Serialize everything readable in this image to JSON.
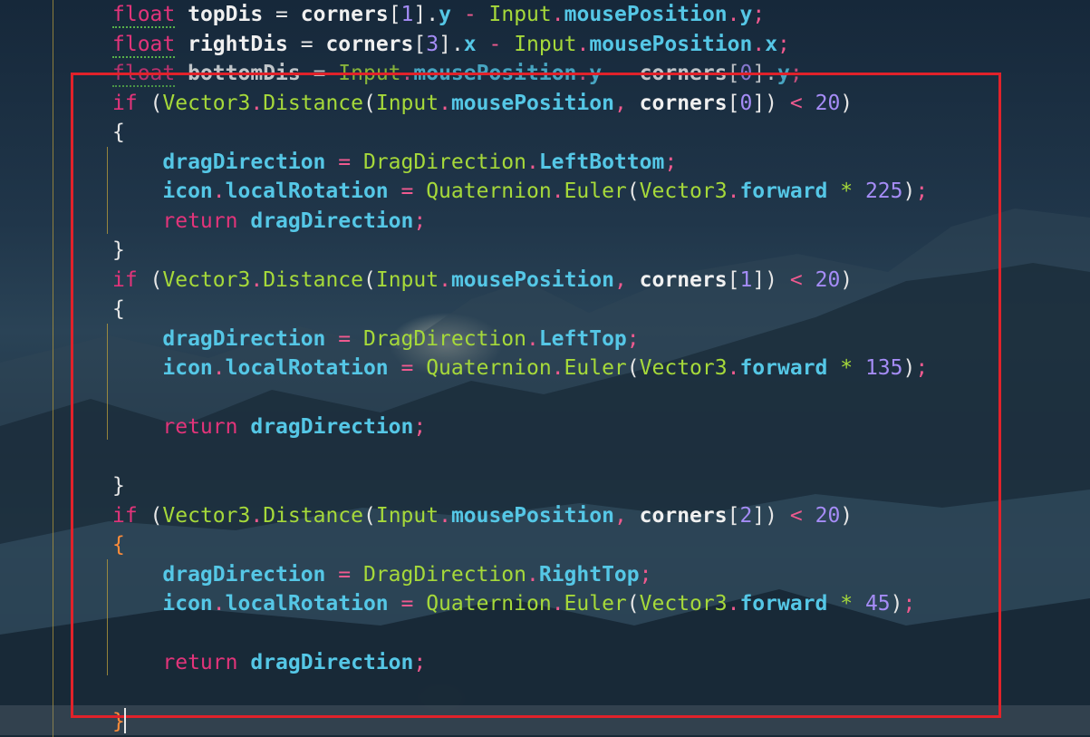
{
  "code": {
    "lines": [
      {
        "tokens": [
          {
            "t": "float",
            "c": "kw squig"
          },
          {
            "t": " ",
            "c": "pn"
          },
          {
            "t": "topDis",
            "c": "var"
          },
          {
            "t": " = ",
            "c": "pn"
          },
          {
            "t": "corners",
            "c": "var"
          },
          {
            "t": "[",
            "c": "pn"
          },
          {
            "t": "1",
            "c": "num"
          },
          {
            "t": "].",
            "c": "pn"
          },
          {
            "t": "y",
            "c": "fld"
          },
          {
            "t": " - ",
            "c": "op"
          },
          {
            "t": "Input",
            "c": "ty"
          },
          {
            "t": ".",
            "c": "op"
          },
          {
            "t": "mousePosition",
            "c": "fld"
          },
          {
            "t": ".",
            "c": "op"
          },
          {
            "t": "y",
            "c": "fld"
          },
          {
            "t": ";",
            "c": "op"
          }
        ]
      },
      {
        "tokens": [
          {
            "t": "float",
            "c": "kw squig"
          },
          {
            "t": " ",
            "c": "pn"
          },
          {
            "t": "rightDis",
            "c": "var"
          },
          {
            "t": " = ",
            "c": "pn"
          },
          {
            "t": "corners",
            "c": "var"
          },
          {
            "t": "[",
            "c": "pn"
          },
          {
            "t": "3",
            "c": "num"
          },
          {
            "t": "].",
            "c": "pn"
          },
          {
            "t": "x",
            "c": "fld"
          },
          {
            "t": " - ",
            "c": "op"
          },
          {
            "t": "Input",
            "c": "ty"
          },
          {
            "t": ".",
            "c": "op"
          },
          {
            "t": "mousePosition",
            "c": "fld"
          },
          {
            "t": ".",
            "c": "op"
          },
          {
            "t": "x",
            "c": "fld"
          },
          {
            "t": ";",
            "c": "op"
          }
        ]
      },
      {
        "tokens": [
          {
            "t": "float",
            "c": "kw squig"
          },
          {
            "t": " ",
            "c": "pn"
          },
          {
            "t": "bottomDis",
            "c": "var"
          },
          {
            "t": " = ",
            "c": "pn"
          },
          {
            "t": "Input",
            "c": "ty"
          },
          {
            "t": ".",
            "c": "op"
          },
          {
            "t": "mousePosition",
            "c": "fld"
          },
          {
            "t": ".",
            "c": "op"
          },
          {
            "t": "y",
            "c": "fld"
          },
          {
            "t": " - ",
            "c": "op"
          },
          {
            "t": "corners",
            "c": "var"
          },
          {
            "t": "[",
            "c": "pn"
          },
          {
            "t": "0",
            "c": "num"
          },
          {
            "t": "].",
            "c": "pn"
          },
          {
            "t": "y",
            "c": "fld"
          },
          {
            "t": ";",
            "c": "op"
          }
        ]
      },
      {
        "tokens": [
          {
            "t": "if",
            "c": "kw"
          },
          {
            "t": " (",
            "c": "pn"
          },
          {
            "t": "Vector3",
            "c": "ty"
          },
          {
            "t": ".",
            "c": "op"
          },
          {
            "t": "Distance",
            "c": "ty"
          },
          {
            "t": "(",
            "c": "pn"
          },
          {
            "t": "Input",
            "c": "ty"
          },
          {
            "t": ".",
            "c": "op"
          },
          {
            "t": "mousePosition",
            "c": "fld"
          },
          {
            "t": ", ",
            "c": "op"
          },
          {
            "t": "corners",
            "c": "var"
          },
          {
            "t": "[",
            "c": "pn"
          },
          {
            "t": "0",
            "c": "num"
          },
          {
            "t": "]) ",
            "c": "pn"
          },
          {
            "t": "<",
            "c": "op"
          },
          {
            "t": " ",
            "c": "pn"
          },
          {
            "t": "20",
            "c": "num"
          },
          {
            "t": ")",
            "c": "pn"
          }
        ]
      },
      {
        "tokens": [
          {
            "t": "{",
            "c": "pn"
          }
        ]
      },
      {
        "tokens": [
          {
            "t": "    ",
            "c": "pn"
          },
          {
            "t": "dragDirection",
            "c": "fld"
          },
          {
            "t": " = ",
            "c": "op"
          },
          {
            "t": "DragDirection",
            "c": "ty"
          },
          {
            "t": ".",
            "c": "op"
          },
          {
            "t": "LeftBottom",
            "c": "fld"
          },
          {
            "t": ";",
            "c": "op"
          }
        ]
      },
      {
        "tokens": [
          {
            "t": "    ",
            "c": "pn"
          },
          {
            "t": "icon",
            "c": "fld"
          },
          {
            "t": ".",
            "c": "op"
          },
          {
            "t": "localRotation",
            "c": "fld"
          },
          {
            "t": " = ",
            "c": "op"
          },
          {
            "t": "Quaternion",
            "c": "ty"
          },
          {
            "t": ".",
            "c": "op"
          },
          {
            "t": "Euler",
            "c": "ty"
          },
          {
            "t": "(",
            "c": "pn"
          },
          {
            "t": "Vector3",
            "c": "ty"
          },
          {
            "t": ".",
            "c": "op"
          },
          {
            "t": "forward",
            "c": "fld"
          },
          {
            "t": " * ",
            "c": "ty"
          },
          {
            "t": "225",
            "c": "num"
          },
          {
            "t": ")",
            "c": "pn"
          },
          {
            "t": ";",
            "c": "op"
          }
        ]
      },
      {
        "tokens": [
          {
            "t": "    ",
            "c": "pn"
          },
          {
            "t": "return",
            "c": "kw"
          },
          {
            "t": " ",
            "c": "pn"
          },
          {
            "t": "dragDirection",
            "c": "fld"
          },
          {
            "t": ";",
            "c": "op"
          }
        ]
      },
      {
        "tokens": [
          {
            "t": "}",
            "c": "pn"
          }
        ]
      },
      {
        "tokens": [
          {
            "t": "if",
            "c": "kw"
          },
          {
            "t": " (",
            "c": "pn"
          },
          {
            "t": "Vector3",
            "c": "ty"
          },
          {
            "t": ".",
            "c": "op"
          },
          {
            "t": "Distance",
            "c": "ty"
          },
          {
            "t": "(",
            "c": "pn"
          },
          {
            "t": "Input",
            "c": "ty"
          },
          {
            "t": ".",
            "c": "op"
          },
          {
            "t": "mousePosition",
            "c": "fld"
          },
          {
            "t": ", ",
            "c": "op"
          },
          {
            "t": "corners",
            "c": "var"
          },
          {
            "t": "[",
            "c": "pn"
          },
          {
            "t": "1",
            "c": "num"
          },
          {
            "t": "]) ",
            "c": "pn"
          },
          {
            "t": "<",
            "c": "op"
          },
          {
            "t": " ",
            "c": "pn"
          },
          {
            "t": "20",
            "c": "num"
          },
          {
            "t": ")",
            "c": "pn"
          }
        ]
      },
      {
        "tokens": [
          {
            "t": "{",
            "c": "pn"
          }
        ]
      },
      {
        "tokens": [
          {
            "t": "    ",
            "c": "pn"
          },
          {
            "t": "dragDirection",
            "c": "fld"
          },
          {
            "t": " = ",
            "c": "op"
          },
          {
            "t": "DragDirection",
            "c": "ty"
          },
          {
            "t": ".",
            "c": "op"
          },
          {
            "t": "LeftTop",
            "c": "fld"
          },
          {
            "t": ";",
            "c": "op"
          }
        ]
      },
      {
        "tokens": [
          {
            "t": "    ",
            "c": "pn"
          },
          {
            "t": "icon",
            "c": "fld"
          },
          {
            "t": ".",
            "c": "op"
          },
          {
            "t": "localRotation",
            "c": "fld"
          },
          {
            "t": " = ",
            "c": "op"
          },
          {
            "t": "Quaternion",
            "c": "ty"
          },
          {
            "t": ".",
            "c": "op"
          },
          {
            "t": "Euler",
            "c": "ty"
          },
          {
            "t": "(",
            "c": "pn"
          },
          {
            "t": "Vector3",
            "c": "ty"
          },
          {
            "t": ".",
            "c": "op"
          },
          {
            "t": "forward",
            "c": "fld"
          },
          {
            "t": " * ",
            "c": "ty"
          },
          {
            "t": "135",
            "c": "num"
          },
          {
            "t": ")",
            "c": "pn"
          },
          {
            "t": ";",
            "c": "op"
          }
        ]
      },
      {
        "tokens": []
      },
      {
        "tokens": [
          {
            "t": "    ",
            "c": "pn"
          },
          {
            "t": "return",
            "c": "kw"
          },
          {
            "t": " ",
            "c": "pn"
          },
          {
            "t": "dragDirection",
            "c": "fld"
          },
          {
            "t": ";",
            "c": "op"
          }
        ]
      },
      {
        "tokens": []
      },
      {
        "tokens": [
          {
            "t": "}",
            "c": "pn"
          }
        ]
      },
      {
        "tokens": [
          {
            "t": "if",
            "c": "kw"
          },
          {
            "t": " (",
            "c": "pn"
          },
          {
            "t": "Vector3",
            "c": "ty"
          },
          {
            "t": ".",
            "c": "op"
          },
          {
            "t": "Distance",
            "c": "ty"
          },
          {
            "t": "(",
            "c": "pn"
          },
          {
            "t": "Input",
            "c": "ty"
          },
          {
            "t": ".",
            "c": "op"
          },
          {
            "t": "mousePosition",
            "c": "fld"
          },
          {
            "t": ", ",
            "c": "op"
          },
          {
            "t": "corners",
            "c": "var"
          },
          {
            "t": "[",
            "c": "pn"
          },
          {
            "t": "2",
            "c": "num"
          },
          {
            "t": "]) ",
            "c": "pn"
          },
          {
            "t": "<",
            "c": "op"
          },
          {
            "t": " ",
            "c": "pn"
          },
          {
            "t": "20",
            "c": "num"
          },
          {
            "t": ")",
            "c": "pn"
          }
        ]
      },
      {
        "tokens": [
          {
            "t": "{",
            "c": "orn"
          }
        ]
      },
      {
        "tokens": [
          {
            "t": "    ",
            "c": "pn"
          },
          {
            "t": "dragDirection",
            "c": "fld"
          },
          {
            "t": " = ",
            "c": "op"
          },
          {
            "t": "DragDirection",
            "c": "ty"
          },
          {
            "t": ".",
            "c": "op"
          },
          {
            "t": "RightTop",
            "c": "fld"
          },
          {
            "t": ";",
            "c": "op"
          }
        ]
      },
      {
        "tokens": [
          {
            "t": "    ",
            "c": "pn"
          },
          {
            "t": "icon",
            "c": "fld"
          },
          {
            "t": ".",
            "c": "op"
          },
          {
            "t": "localRotation",
            "c": "fld"
          },
          {
            "t": " = ",
            "c": "op"
          },
          {
            "t": "Quaternion",
            "c": "ty"
          },
          {
            "t": ".",
            "c": "op"
          },
          {
            "t": "Euler",
            "c": "ty"
          },
          {
            "t": "(",
            "c": "pn"
          },
          {
            "t": "Vector3",
            "c": "ty"
          },
          {
            "t": ".",
            "c": "op"
          },
          {
            "t": "forward",
            "c": "fld"
          },
          {
            "t": " * ",
            "c": "ty"
          },
          {
            "t": "45",
            "c": "num"
          },
          {
            "t": ")",
            "c": "pn"
          },
          {
            "t": ";",
            "c": "op"
          }
        ]
      },
      {
        "tokens": []
      },
      {
        "tokens": [
          {
            "t": "    ",
            "c": "pn"
          },
          {
            "t": "return",
            "c": "kw"
          },
          {
            "t": " ",
            "c": "pn"
          },
          {
            "t": "dragDirection",
            "c": "fld"
          },
          {
            "t": ";",
            "c": "op"
          }
        ]
      },
      {
        "tokens": []
      },
      {
        "tokens": [
          {
            "t": "}",
            "c": "orn"
          }
        ]
      }
    ]
  },
  "colors": {
    "keyword": "#e2347a",
    "type": "#a6d93a",
    "field": "#55c7e6",
    "number": "#a58cf6",
    "operator": "#ef5a8f",
    "matched_brace": "#ff8c3a",
    "indent_guide": "#b49a3c",
    "selection_box": "#e1222a"
  }
}
